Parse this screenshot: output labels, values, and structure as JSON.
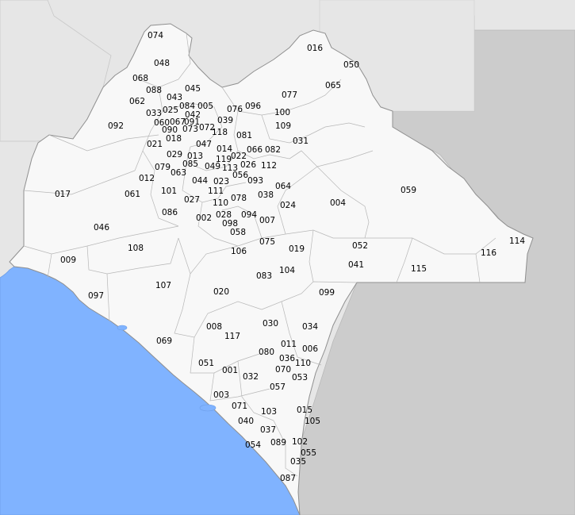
{
  "colors": {
    "ocean": "#80b3ff",
    "neighbor_light": "#e6e6e6",
    "neighbor_dark": "#cccccc",
    "state_fill": "#f8f8f8",
    "border": "#9a9a9a",
    "label": "#000000"
  },
  "municipalities": [
    "074",
    "048",
    "016",
    "050",
    "068",
    "065",
    "088",
    "045",
    "077",
    "043",
    "062",
    "084",
    "005",
    "096",
    "076",
    "025",
    "042",
    "100",
    "033",
    "091",
    "039",
    "060",
    "067",
    "109",
    "092",
    "072",
    "090",
    "073",
    "118",
    "081",
    "018",
    "047",
    "031",
    "066",
    "082",
    "021",
    "014",
    "119",
    "029",
    "022",
    "013",
    "026",
    "112",
    "085",
    "079",
    "049",
    "113",
    "056",
    "063",
    "012",
    "044",
    "023",
    "093",
    "064",
    "111",
    "101",
    "059",
    "038",
    "017",
    "061",
    "027",
    "078",
    "110",
    "024",
    "004",
    "002",
    "028",
    "094",
    "086",
    "098",
    "007",
    "058",
    "046",
    "114",
    "052",
    "075",
    "019",
    "108",
    "106",
    "116",
    "009",
    "041",
    "115",
    "104",
    "083",
    "097",
    "107",
    "020",
    "099",
    "030",
    "008",
    "034",
    "117",
    "069",
    "011",
    "006",
    "080",
    "036",
    "110b",
    "051",
    "070",
    "001",
    "053",
    "032",
    "057",
    "003",
    "071",
    "103",
    "015",
    "105",
    "040",
    "037",
    "054",
    "089",
    "102",
    "055",
    "035",
    "087"
  ]
}
